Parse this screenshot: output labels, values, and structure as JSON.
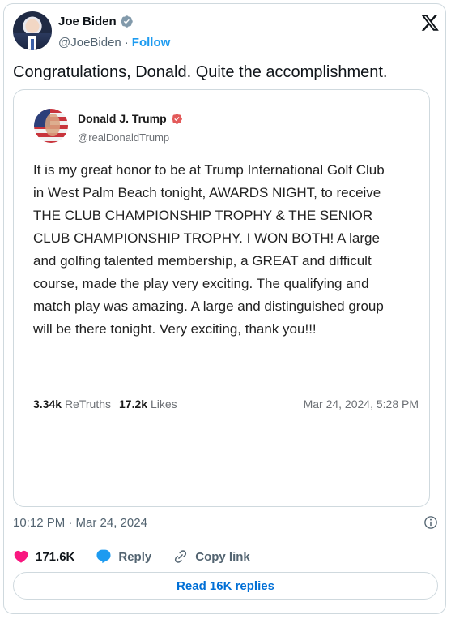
{
  "author": {
    "name": "Joe Biden",
    "handle": "@JoeBiden",
    "separator": "·",
    "follow_label": "Follow"
  },
  "tweet": {
    "text": "Congratulations, Donald. Quite the accomplishment."
  },
  "embedded_post": {
    "name": "Donald J. Trump",
    "handle": "@realDonaldTrump",
    "body": "It is my great honor to be at Trump International Golf Club in West Palm Beach tonight, AWARDS NIGHT, to receive THE CLUB CHAMPIONSHIP TROPHY & THE SENIOR CLUB CHAMPIONSHIP TROPHY. I WON BOTH! A large and golfing talented membership, a GREAT and difficult course, made the play very exciting. The qualifying and match play was amazing. A large and distinguished group will be there tonight. Very exciting,  thank you!!!",
    "retruths_count": "3.34k",
    "retruths_label": "ReTruths",
    "likes_count": "17.2k",
    "likes_label": "Likes",
    "date": "Mar 24, 2024, 5:28 PM"
  },
  "meta": {
    "timestamp": "10:12 PM · Mar 24, 2024"
  },
  "actions": {
    "like_count": "171.6K",
    "reply_label": "Reply",
    "copy_label": "Copy link"
  },
  "read_replies_label": "Read 16K replies",
  "colors": {
    "accent": "#1d9bf0",
    "like": "#f91880",
    "truth_verified": "#e35a5a",
    "muted": "#536471"
  },
  "icons": [
    "verified-badge-icon",
    "x-logo-icon",
    "truth-verified-icon",
    "info-icon",
    "heart-icon",
    "reply-bubble-icon",
    "link-icon"
  ]
}
